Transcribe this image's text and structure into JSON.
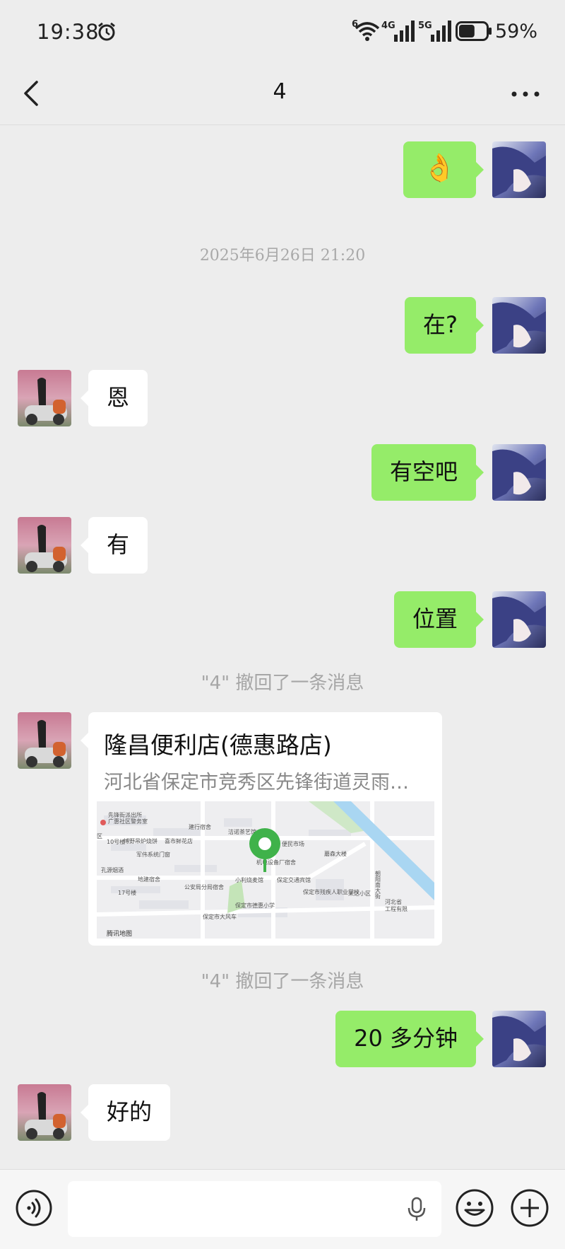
{
  "status_bar": {
    "time": "19:38",
    "battery_percent": "59%",
    "battery_level": 0.59,
    "network_a": "4G",
    "network_b": "5G",
    "wifi_tag": "6"
  },
  "header": {
    "back_icon": "chevron-left-icon",
    "title": "4",
    "more_icon": "more-horizontal-icon"
  },
  "messages": [
    {
      "from": "me",
      "emoji": "👌"
    },
    {
      "type": "timestamp",
      "text": "2025年6月26日 21:20"
    },
    {
      "from": "me",
      "text": "在?"
    },
    {
      "from": "other",
      "text": "恩"
    },
    {
      "from": "me",
      "text": "有空吧"
    },
    {
      "from": "other",
      "text": "有"
    },
    {
      "from": "me",
      "text": "位置"
    },
    {
      "type": "system",
      "text": "\"4\" 撤回了一条消息"
    },
    {
      "from": "other",
      "type": "location",
      "name": "隆昌便利店(德惠路店)",
      "address": "河北省保定市竞秀区先锋街道灵雨…",
      "map_labels": {
        "l1": "先锋街派出所",
        "l2": "广惠社区警务室",
        "l3": "建行宿舍",
        "l4": "洁诺茶艺馆",
        "l5": "博野吊炉烧饼",
        "l6": "喜市鲜花店",
        "l7": "便民市场",
        "l8": "蘑森大楼",
        "l9": "军伟系统门窗",
        "l10": "孔源烟酒",
        "l11": "小利烧麦馆",
        "l12": "保定交通宾馆",
        "l13": "公安局分局宿舍",
        "l14": "保定市残疾人职业学校",
        "l15": "荣达小区",
        "l16": "保定市德惠小学",
        "l17": "保定市大风车",
        "l18": "河北省",
        "l19": "工程有限",
        "l20": "朝阳南大街",
        "l21": "地建宿舍",
        "l22": "17号楼",
        "l23": "10号楼",
        "l24": "腾讯地图",
        "l25": "机电设备厂宿舍",
        "l26": "区"
      }
    },
    {
      "type": "system",
      "text": "\"4\" 撤回了一条消息"
    },
    {
      "from": "me",
      "text": "20 多分钟"
    },
    {
      "from": "other",
      "text": "好的"
    }
  ],
  "input_bar": {
    "voice_icon": "voice-mode-icon",
    "input_value": "",
    "mic_icon": "microphone-icon",
    "emoji_icon": "emoji-icon",
    "plus_icon": "plus-icon"
  },
  "colors": {
    "background": "#ededed",
    "my_bubble": "#95ec69",
    "other_bubble": "#ffffff",
    "map_pin": "#3fb24a"
  }
}
